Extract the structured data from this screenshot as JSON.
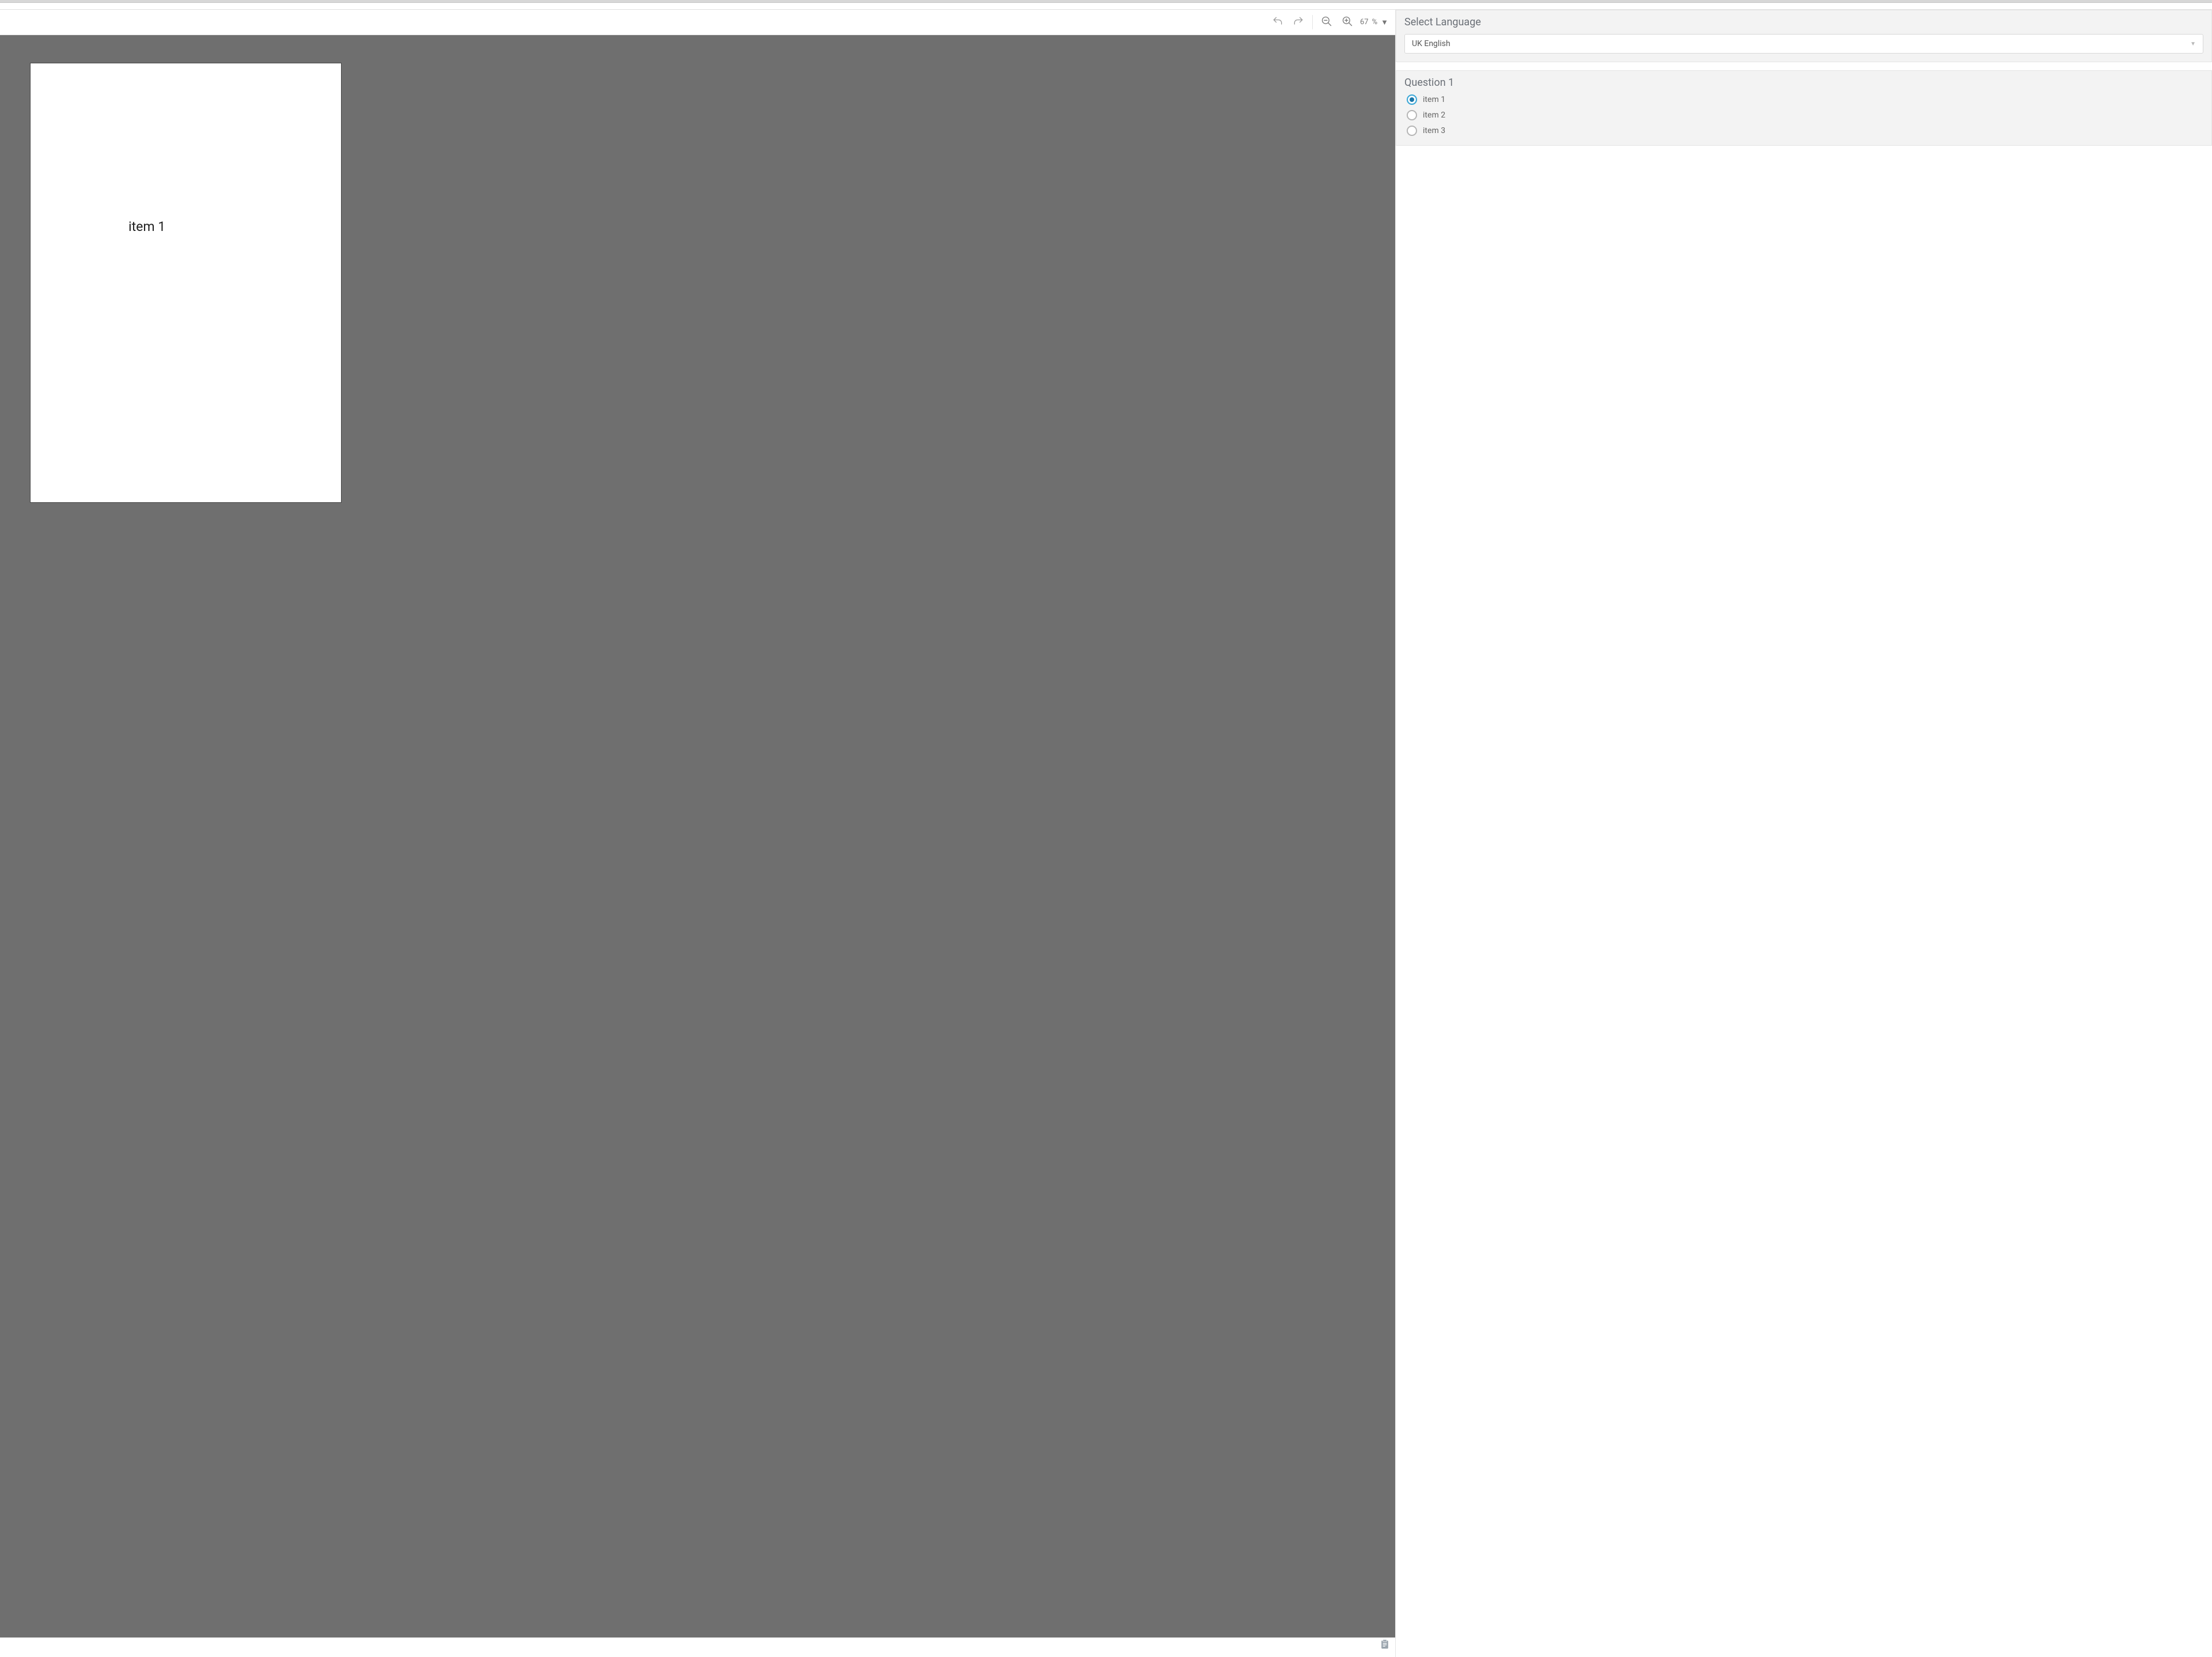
{
  "toolbar": {
    "zoom_value": "67",
    "zoom_unit": "%"
  },
  "canvas": {
    "page_text": "item 1"
  },
  "sidebar": {
    "language_panel": {
      "title": "Select Language",
      "selected": "UK English"
    },
    "question_panel": {
      "title": "Question 1",
      "options": [
        {
          "label": "item 1",
          "selected": true
        },
        {
          "label": "item 2",
          "selected": false
        },
        {
          "label": "item 3",
          "selected": false
        }
      ]
    }
  }
}
